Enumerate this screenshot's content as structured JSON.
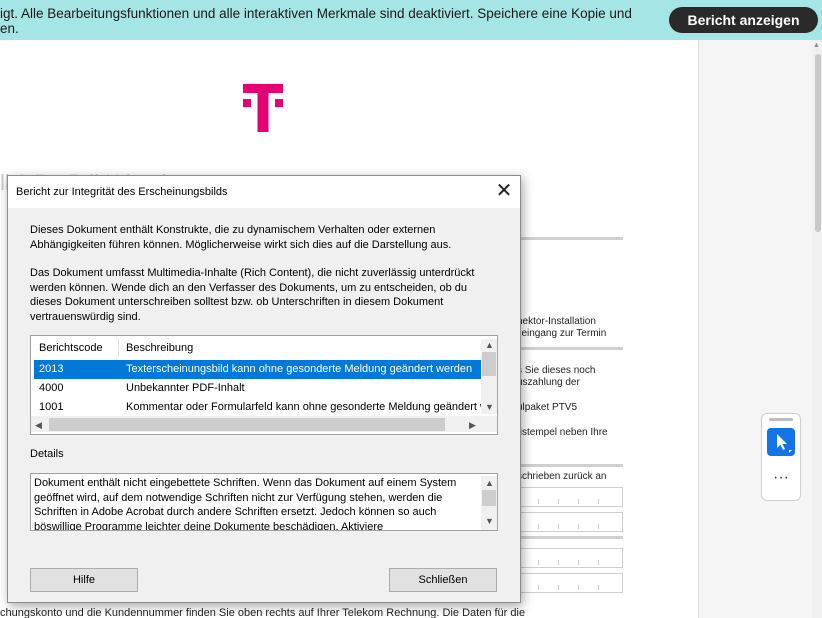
{
  "banner": {
    "text_line1": "igt. Alle Bearbeitungsfunktionen und alle interaktiven Merkmale sind deaktiviert. Speichere eine Kopie und",
    "text_line2": "en.",
    "report_button": "Bericht anzeigen",
    "color": "#a6e5e6"
  },
  "document": {
    "logo": "telekom-t-logo",
    "brand_color": "#e20074",
    "heading_fragment": "ll A   D   t B   ll   K   kt   t      l",
    "right_fragments": [
      "nektor-Installation",
      "lleingang zur Termin",
      "s Sie dieses noch",
      "uszahlung der",
      "ulpaket PTV5",
      "tistempel neben Ihre",
      "schrieben zurück an"
    ],
    "bottom_text": "chungskonto und die Kundennummer finden Sie oben rechts auf Ihrer Telekom Rechnung. Die Daten für die"
  },
  "tools": {
    "select_icon": "cursor-arrow-icon",
    "more_label": "···"
  },
  "dialog": {
    "title": "Bericht zur Integrität des Erscheinungsbilds",
    "close_icon": "close-icon",
    "para1": "Dieses Dokument enthält Konstrukte, die zu dynamischem Verhalten oder externen Abhängigkeiten führen können. Möglicherweise wirkt sich dies auf die Darstellung aus.",
    "para2": "Das Dokument umfasst Multimedia-Inhalte (Rich Content), die nicht zuverlässig unterdrückt werden können. Wende dich an den Verfasser des Dokuments, um zu entscheiden, ob du dieses Dokument unterschreiben solltest bzw. ob Unterschriften in diesem Dokument vertrauenswürdig sind.",
    "table": {
      "headers": [
        "Berichtscode",
        "Beschreibung"
      ],
      "rows": [
        {
          "code": "2013",
          "desc": "Texterscheinungsbild kann ohne gesonderte Meldung geändert werden"
        },
        {
          "code": "4000",
          "desc": "Unbekannter PDF-Inhalt"
        },
        {
          "code": "1001",
          "desc": "Kommentar oder Formularfeld kann ohne gesonderte Meldung geändert werden"
        }
      ],
      "selected_row": 0
    },
    "details_label": "Details",
    "details_text": "Dokument enthält nicht eingebettete Schriften. Wenn das Dokument auf einem System geöffnet wird, auf dem notwendige Schriften nicht zur Verfügung stehen, werden die Schriften in Adobe Acrobat durch andere Schriften ersetzt. Jedoch können so auch böswillige Programme leichter deine Dokumente beschädigen. Aktiviere",
    "help_button": "Hilfe",
    "close_button": "Schließen"
  }
}
